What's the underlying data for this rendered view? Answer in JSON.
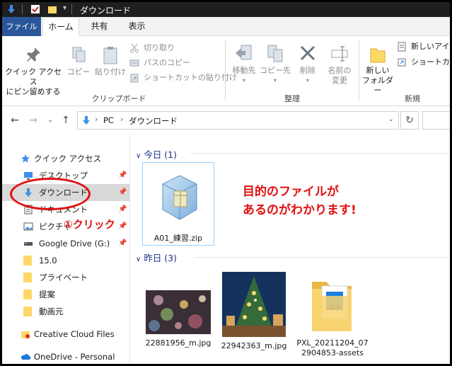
{
  "window": {
    "title": "ダウンロード"
  },
  "ribbon_tabs": [
    "ファイル",
    "ホーム",
    "共有",
    "表示"
  ],
  "ribbon": {
    "pin_quick_access": "クイック アクセス\nにピン留めする",
    "copy": "コピー",
    "paste": "貼り付け",
    "cut": "切り取り",
    "copy_path": "パスのコピー",
    "paste_shortcut": "ショートカットの貼り付け",
    "clipboard_group": "クリップボード",
    "move_to": "移動先",
    "copy_to": "コピー先",
    "delete": "削除",
    "rename": "名前の\n変更",
    "organize_group": "整理",
    "new_folder": "新しい\nフォルダー",
    "new_item": "新しいアイテ",
    "shortcut": "ショートカッ",
    "new_group": "新規"
  },
  "address": {
    "crumbs": [
      "PC",
      "ダウンロード"
    ]
  },
  "nav": {
    "items": [
      {
        "label": "クイック アクセス",
        "icon": "star-icon",
        "pinned": false
      },
      {
        "label": "デスクトップ",
        "icon": "desktop-icon",
        "pinned": true
      },
      {
        "label": "ダウンロード",
        "icon": "download-arrow-icon",
        "pinned": true
      },
      {
        "label": "ドキュメント",
        "icon": "document-icon",
        "pinned": true
      },
      {
        "label": "ピクチャ",
        "icon": "pictures-icon",
        "pinned": true
      },
      {
        "label": "Google Drive (G:)",
        "icon": "drive-icon",
        "pinned": true
      },
      {
        "label": "15.0",
        "icon": "folder-icon",
        "pinned": false
      },
      {
        "label": "プライベート",
        "icon": "folder-icon",
        "pinned": false
      },
      {
        "label": "提案",
        "icon": "folder-icon",
        "pinned": false
      },
      {
        "label": "動画元",
        "icon": "folder-icon",
        "pinned": false
      },
      {
        "label": "Creative Cloud Files",
        "icon": "creative-cloud-icon",
        "pinned": false
      },
      {
        "label": "OneDrive - Personal",
        "icon": "onedrive-icon",
        "pinned": false
      }
    ]
  },
  "content": {
    "groups": [
      {
        "label": "今日 (1)"
      },
      {
        "label": "昨日 (3)"
      }
    ],
    "files": [
      {
        "name": "A01_練習.zip"
      },
      {
        "name": "22881956_m.jpg"
      },
      {
        "name": "22942363_m.jpg"
      },
      {
        "name": "PXL_20211204_07\n2904853-assets"
      }
    ]
  },
  "annotations": {
    "message": "目的のファイルが\nあるのがわかります!",
    "step": "①クリック"
  },
  "colors": {
    "annotation_red": "#e01010",
    "file_tab_blue": "#2b579a",
    "group_header": "#1e3287"
  }
}
